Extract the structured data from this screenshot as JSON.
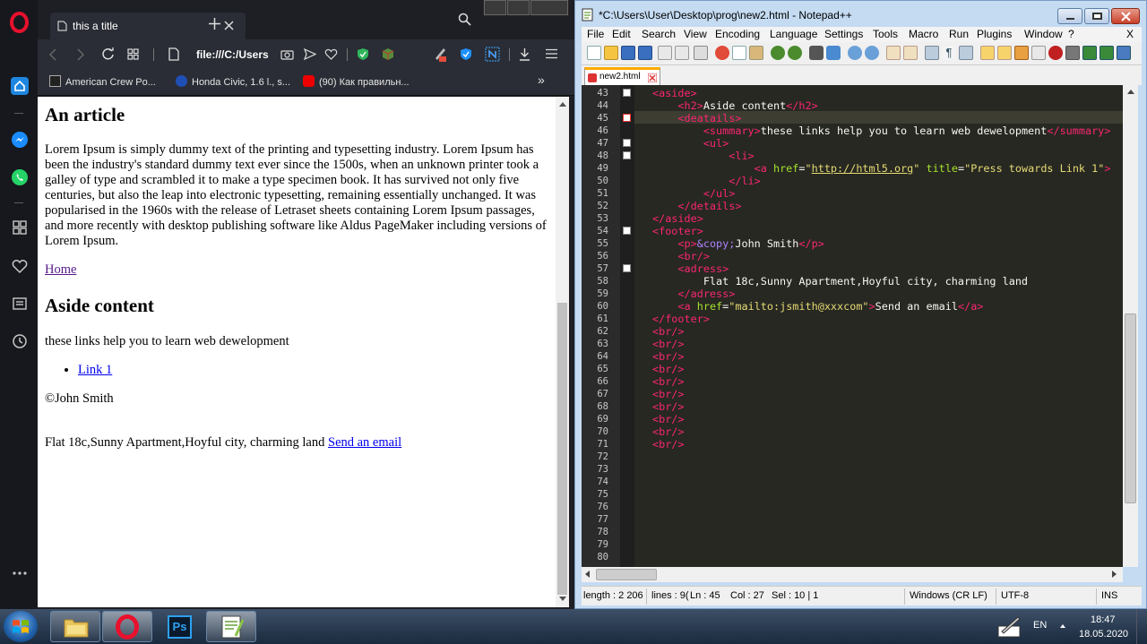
{
  "opera": {
    "tab_title": "this a title",
    "url": "file:///C:/Users",
    "bookmarks": [
      {
        "label": "American Crew Po..."
      },
      {
        "label": "Honda Civic, 1.6 l., s..."
      },
      {
        "label": "(90) Как правильн..."
      }
    ],
    "page": {
      "article_heading": "An article",
      "article_text": "Lorem Ipsum is simply dummy text of the printing and typesetting industry. Lorem Ipsum has been the industry's standard dummy text ever since the 1500s, when an unknown printer took a galley of type and scrambled it to make a type specimen book. It has survived not only five centuries, but also the leap into electronic typesetting, remaining essentially unchanged. It was popularised in the 1960s with the release of Letraset sheets containing Lorem Ipsum passages, and more recently with desktop publishing software like Aldus PageMaker including versions of Lorem Ipsum.",
      "home_link": "Home",
      "aside_heading": "Aside content",
      "summary": "these links help you to learn web dewelopment",
      "link1": "Link 1",
      "copyright": "©John Smith",
      "address": "Flat 18c,Sunny Apartment,Hoyful city, charming land",
      "email_link": "Send an email"
    }
  },
  "npp": {
    "title": "*C:\\Users\\User\\Desktop\\prog\\new2.html - Notepad++",
    "menu": [
      "File",
      "Edit",
      "Search",
      "View",
      "Encoding",
      "Language",
      "Settings",
      "Tools",
      "Macro",
      "Run",
      "Plugins",
      "Window",
      "?"
    ],
    "menu_close": "X",
    "tab_name": "new2.html",
    "lines": [
      {
        "n": "43",
        "html": "<span class=\"tag\">&lt;aside&gt;</span>"
      },
      {
        "n": "44",
        "html": "    <span class=\"tag\">&lt;h2&gt;</span>Aside content<span class=\"tag\">&lt;/h2&gt;</span>"
      },
      {
        "n": "45",
        "html": "    <span class=\"tag\">&lt;deatails&gt;</span>"
      },
      {
        "n": "46",
        "html": "        <span class=\"tag\">&lt;summary&gt;</span>these links help you to learn web dewelopment<span class=\"tag\">&lt;/summary&gt;</span>"
      },
      {
        "n": "47",
        "html": "        <span class=\"tag\">&lt;ul&gt;</span>"
      },
      {
        "n": "48",
        "html": "            <span class=\"tag\">&lt;li&gt;</span>"
      },
      {
        "n": "49",
        "html": "                <span class=\"tag\">&lt;a</span> <span class=\"attr\">href</span>=<span class=\"str\">\"<u>http://html5.org</u>\"</span> <span class=\"attr\">title</span>=<span class=\"str\">\"Press towards Link 1\"</span><span class=\"tag\">&gt;</span>"
      },
      {
        "n": "50",
        "html": "            <span class=\"tag\">&lt;/li&gt;</span>"
      },
      {
        "n": "51",
        "html": "        <span class=\"tag\">&lt;/ul&gt;</span>"
      },
      {
        "n": "52",
        "html": "    <span class=\"tag\">&lt;/details&gt;</span>"
      },
      {
        "n": "53",
        "html": "<span class=\"tag\">&lt;/aside&gt;</span>"
      },
      {
        "n": "54",
        "html": "<span class=\"tag\">&lt;footer&gt;</span>"
      },
      {
        "n": "55",
        "html": "    <span class=\"tag\">&lt;p&gt;</span><span class=\"ent\">&amp;copy;</span>John Smith<span class=\"tag\">&lt;/p&gt;</span>"
      },
      {
        "n": "56",
        "html": "    <span class=\"tag\">&lt;br/&gt;</span>"
      },
      {
        "n": "57",
        "html": "    <span class=\"tag\">&lt;adress&gt;</span>"
      },
      {
        "n": "58",
        "html": "        Flat 18c,Sunny Apartment,Hoyful city, charming land"
      },
      {
        "n": "59",
        "html": "    <span class=\"tag\">&lt;/adress&gt;</span>"
      },
      {
        "n": "60",
        "html": "    <span class=\"tag\">&lt;a</span> <span class=\"attr\">href</span>=<span class=\"str\">\"mailto:jsmith@xxxcom\"</span><span class=\"tag\">&gt;</span>Send an email<span class=\"tag\">&lt;/a&gt;</span>"
      },
      {
        "n": "61",
        "html": "<span class=\"tag\">&lt;/footer&gt;</span>"
      },
      {
        "n": "62",
        "html": "<span class=\"tag\">&lt;br/&gt;</span>"
      },
      {
        "n": "63",
        "html": "<span class=\"tag\">&lt;br/&gt;</span>"
      },
      {
        "n": "64",
        "html": "<span class=\"tag\">&lt;br/&gt;</span>"
      },
      {
        "n": "65",
        "html": "<span class=\"tag\">&lt;br/&gt;</span>"
      },
      {
        "n": "66",
        "html": "<span class=\"tag\">&lt;br/&gt;</span>"
      },
      {
        "n": "67",
        "html": "<span class=\"tag\">&lt;br/&gt;</span>"
      },
      {
        "n": "68",
        "html": "<span class=\"tag\">&lt;br/&gt;</span>"
      },
      {
        "n": "69",
        "html": "<span class=\"tag\">&lt;br/&gt;</span>"
      },
      {
        "n": "70",
        "html": "<span class=\"tag\">&lt;br/&gt;</span>"
      },
      {
        "n": "71",
        "html": "<span class=\"tag\">&lt;br/&gt;</span>"
      },
      {
        "n": "72",
        "html": ""
      },
      {
        "n": "73",
        "html": ""
      },
      {
        "n": "74",
        "html": ""
      },
      {
        "n": "75",
        "html": ""
      },
      {
        "n": "76",
        "html": ""
      },
      {
        "n": "77",
        "html": ""
      },
      {
        "n": "78",
        "html": ""
      },
      {
        "n": "79",
        "html": ""
      },
      {
        "n": "80",
        "html": ""
      }
    ],
    "status": {
      "length": "length : 2 206",
      "lines": "lines : 9(",
      "ln": "Ln : 45",
      "col": "Col : 27",
      "sel": "Sel : 10 | 1",
      "eol": "Windows (CR LF)",
      "enc": "UTF-8",
      "ins": "INS"
    }
  },
  "taskbar": {
    "lang": "EN",
    "time": "18:47",
    "date": "18.05.2020"
  },
  "colors": {
    "tag": "#f92672",
    "attr": "#a6e22e",
    "string": "#e6db74",
    "entity": "#ae81ff"
  },
  "icons": [
    "opera-logo-icon",
    "search-icon",
    "close-icon",
    "plus-icon",
    "back-icon",
    "forward-icon",
    "reload-icon",
    "tabs-icon",
    "file-icon",
    "camera-icon",
    "send-icon",
    "heart-icon",
    "shield-icon",
    "download-icon",
    "menu-icon",
    "home-icon",
    "messenger-icon",
    "whatsapp-icon",
    "history-icon",
    "start-icon",
    "folder-icon",
    "photoshop-icon",
    "notepadpp-icon"
  ]
}
